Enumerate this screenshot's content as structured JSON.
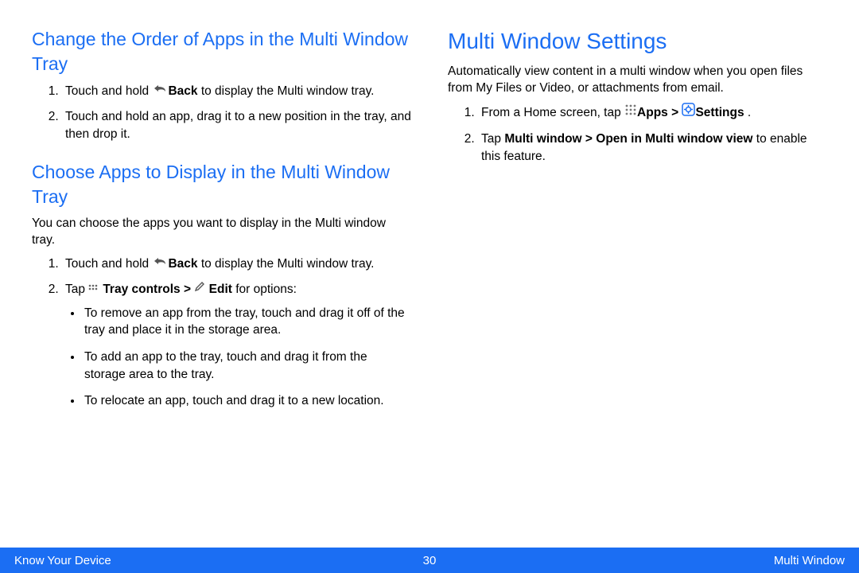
{
  "left": {
    "section1": {
      "heading": "Change the Order of Apps in the Multi Window Tray",
      "steps": {
        "s1a": "Touch and hold ",
        "s1b": "Back",
        "s1c": " to display the Multi window tray.",
        "s2": "Touch and hold an app, drag it to a new position in the tray, and then drop it."
      }
    },
    "section2": {
      "heading": "Choose Apps to Display in the Multi Window Tray",
      "intro": "You can choose the apps you want to display in the Multi window tray.",
      "steps": {
        "s1a": "Touch and hold ",
        "s1b": "Back",
        "s1c": " to display the Multi window tray.",
        "s2a": "Tap ",
        "s2b": "Tray controls > ",
        "s2c": " Edit",
        "s2d": " for options:",
        "bullets": {
          "b1": "To remove an app from the tray, touch and drag it off of the tray and place it in the storage area.",
          "b2": "To add an app to the tray, touch and drag it from the storage area to the tray.",
          "b3": "To relocate an app, touch and drag it to a new location."
        }
      }
    }
  },
  "right": {
    "heading": "Multi Window Settings",
    "intro": "Automatically view content in a multi window when you open files from My Files or Video, or attachments from email.",
    "steps": {
      "s1a": "From a Home screen, tap ",
      "s1b": "Apps > ",
      "s1c": "Settings",
      "s1d": " .",
      "s2a": "Tap ",
      "s2b": "Multi window > Open in Multi window view",
      "s2c": " to enable this feature."
    }
  },
  "footer": {
    "left": "Know Your Device",
    "page": "30",
    "right": "Multi Window"
  }
}
